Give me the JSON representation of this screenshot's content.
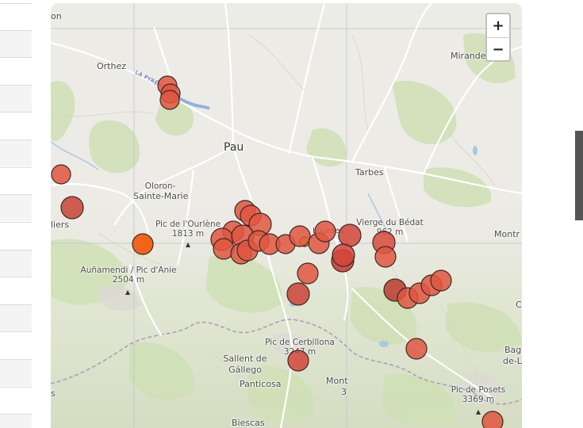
{
  "map": {
    "zoom_in_label": "+",
    "zoom_out_label": "−",
    "labels": {
      "on": "on",
      "orthez": "Orthez",
      "mirande": "Mirande",
      "pau": "Pau",
      "tarbes": "Tarbes",
      "oloron_1": "Oloron-",
      "oloron_2": "Sainte-Marie",
      "liers": "liers",
      "pic_ourlene_1": "Pic de l'Ourlène",
      "pic_ourlene_2": "1813 m",
      "vierge_1": "Vierge du Bédat",
      "vierge_2": "962 m",
      "lourdes": "Lourdes",
      "montr": "Montr",
      "aunamendi_1": "Auñamendi / Pic d'Anie",
      "aunamendi_2": "2504 m",
      "pic_cerbillona_1": "Pic de Cerbillona",
      "pic_cerbillona_2": "3247 m",
      "sallent_1": "Sallent de",
      "sallent_2": "Gállego",
      "panticosa": "Panticosa",
      "mont": "Mont",
      "mont_2": "3",
      "bag_1": "Bag",
      "bag_2": "de-L",
      "c": "C",
      "s": "s",
      "pic_posets_1": "Pic de Posets",
      "pic_posets_2": "3369 m",
      "biescas": "Biescas",
      "road": "LA PYRÉNÉENNE"
    },
    "colors": {
      "marker_fill": "#e0563f",
      "marker_dark": "#b8392e",
      "marker_orange": "#f26419",
      "marker_yellow": "#e8d21e",
      "marker_stroke": "#3a2a28",
      "water": "#a9c8e6",
      "forest": "#cfe0b5"
    }
  }
}
